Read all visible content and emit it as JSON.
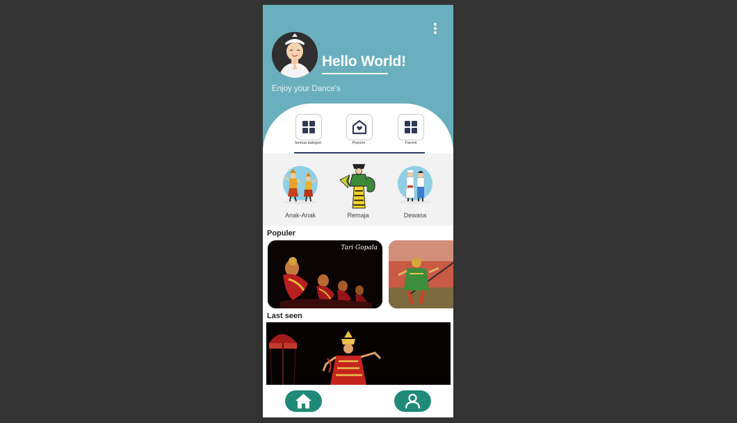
{
  "header": {
    "greeting": "Hello World!",
    "subtitle": "Enjoy your Dance's",
    "menu_icon": "more-vertical-icon",
    "avatar": "avatar"
  },
  "tabs": [
    {
      "label": "Semua kategori",
      "icon": "grid-icon"
    },
    {
      "label": "Populer",
      "icon": "home-heart-icon"
    },
    {
      "label": "Favorit",
      "icon": "grid-icon"
    }
  ],
  "categories": [
    {
      "label": "Anak-Anak"
    },
    {
      "label": "Remaja"
    },
    {
      "label": "Dewasa"
    }
  ],
  "populer": {
    "title": "Populer",
    "cards": [
      {
        "caption": "Tari Gopala"
      },
      {
        "caption": ""
      }
    ]
  },
  "last_seen": {
    "title": "Last seen"
  },
  "bottom_nav": [
    {
      "icon": "home-icon"
    },
    {
      "icon": "profile-icon"
    }
  ],
  "colors": {
    "header": "#69afbd",
    "accent": "#1f8a78",
    "background": "#333333",
    "tab_underline": "#2f3b60"
  }
}
